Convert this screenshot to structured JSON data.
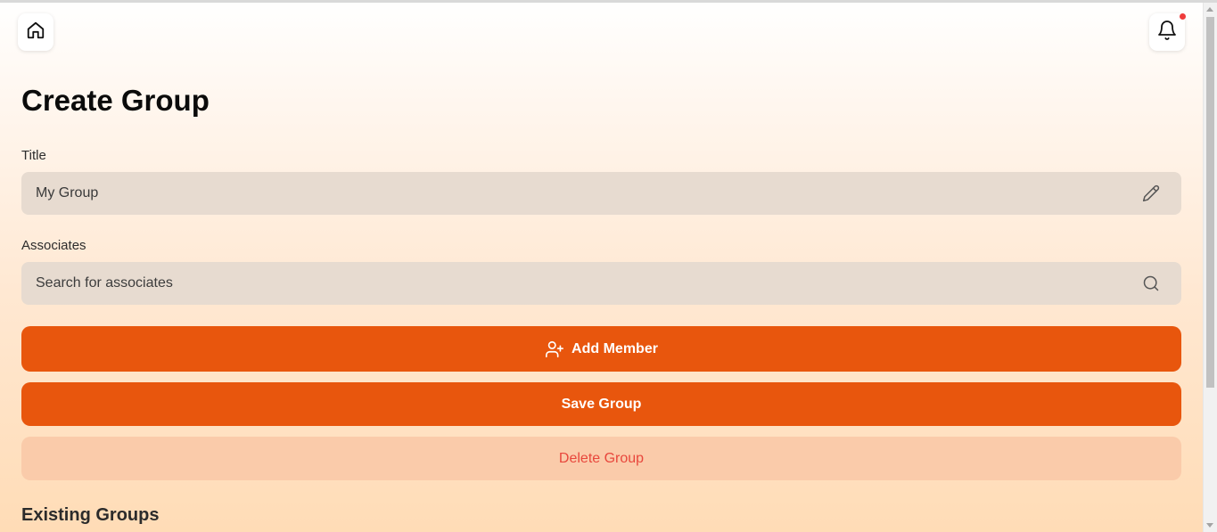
{
  "header": {
    "home_icon": "home-icon",
    "bell_icon": "bell-icon",
    "has_notification": true
  },
  "page": {
    "title": "Create Group"
  },
  "form": {
    "title_label": "Title",
    "title_value": "My Group",
    "title_placeholder": "",
    "title_icon": "pencil-icon",
    "associates_label": "Associates",
    "associates_value": "",
    "associates_placeholder": "Search for associates",
    "associates_icon": "search-icon"
  },
  "actions": {
    "add_member_label": "Add Member",
    "add_member_icon": "user-plus-icon",
    "save_label": "Save Group",
    "delete_label": "Delete Group"
  },
  "existing": {
    "heading": "Existing Groups"
  },
  "colors": {
    "accent": "#e8560d",
    "danger_text": "#e8473c",
    "danger_bg": "#facbaa",
    "field_bg": "#e7dbd0",
    "notification_dot": "#ef3b3b"
  }
}
